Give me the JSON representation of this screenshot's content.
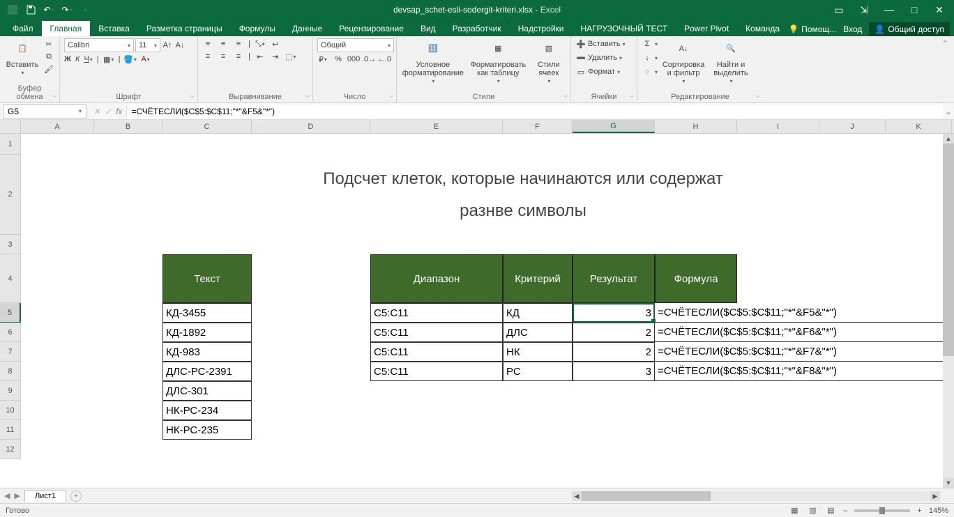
{
  "title": {
    "filename": "devsap_schet-esli-sodergit-kriteri.xlsx",
    "app": "Excel"
  },
  "tabs": [
    "Файл",
    "Главная",
    "Вставка",
    "Разметка страницы",
    "Формулы",
    "Данные",
    "Рецензирование",
    "Вид",
    "Разработчик",
    "Надстройки",
    "НАГРУЗОЧНЫЙ ТЕСТ",
    "Power Pivot",
    "Команда"
  ],
  "activeTab": 1,
  "help": "Помощ...",
  "signin": "Вход",
  "share": "Общий доступ",
  "ribbon": {
    "clipboard": {
      "paste": "Вставить",
      "label": "Буфер обмена"
    },
    "font": {
      "name": "Calibri",
      "size": "11",
      "label": "Шрифт"
    },
    "align": {
      "label": "Выравнивание"
    },
    "number": {
      "format": "Общий",
      "label": "Число"
    },
    "styles": {
      "cond": "Условное форматирование",
      "table": "Форматировать как таблицу",
      "cell": "Стили ячеек",
      "label": "Стили"
    },
    "cells": {
      "insert": "Вставить",
      "delete": "Удалить",
      "format": "Формат",
      "label": "Ячейки"
    },
    "editing": {
      "sort": "Сортировка и фильтр",
      "find": "Найти и выделить",
      "label": "Редактирование"
    }
  },
  "namebox": "G5",
  "formula": "=СЧЁТЕСЛИ($C$5:$C$11;\"*\"&F5&\"*\")",
  "cols": [
    {
      "l": "A",
      "w": 105
    },
    {
      "l": "B",
      "w": 98
    },
    {
      "l": "C",
      "w": 128
    },
    {
      "l": "D",
      "w": 170
    },
    {
      "l": "E",
      "w": 190
    },
    {
      "l": "F",
      "w": 100
    },
    {
      "l": "G",
      "w": 118
    },
    {
      "l": "H",
      "w": 118
    },
    {
      "l": "I",
      "w": 118
    },
    {
      "l": "J",
      "w": 95
    },
    {
      "l": "K",
      "w": 95
    }
  ],
  "rows": [
    {
      "n": 1,
      "h": 30
    },
    {
      "n": 2,
      "h": 115
    },
    {
      "n": 3,
      "h": 28
    },
    {
      "n": 4,
      "h": 70
    },
    {
      "n": 5,
      "h": 28
    },
    {
      "n": 6,
      "h": 28
    },
    {
      "n": 7,
      "h": 28
    },
    {
      "n": 8,
      "h": 28
    },
    {
      "n": 9,
      "h": 28
    },
    {
      "n": 10,
      "h": 28
    },
    {
      "n": 11,
      "h": 28
    },
    {
      "n": 12,
      "h": 28
    }
  ],
  "titleLine1": "Подсчет клеток, которые начинаются или содержат",
  "titleLine2": "разнве символы",
  "headers": {
    "text": "Текст",
    "range": "Диапазон",
    "crit": "Критерий",
    "res": "Результат",
    "form": "Формула"
  },
  "textCol": [
    "КД-3455",
    "КД-1892",
    "КД-983",
    "ДЛС-РС-2391",
    "ДЛС-301",
    "НК-РС-234",
    "НК-РС-235"
  ],
  "rangeCol": [
    "C5:C11",
    "C5:C11",
    "C5:C11",
    "C5:C11"
  ],
  "critCol": [
    "КД",
    "ДЛС",
    "НК",
    "РС"
  ],
  "resCol": [
    "3",
    "2",
    "2",
    "3"
  ],
  "formCol": [
    "=СЧЁТЕСЛИ($C$5:$C$11;\"*\"&F5&\"*\")",
    "=СЧЁТЕСЛИ($C$5:$C$11;\"*\"&F6&\"*\")",
    "=СЧЁТЕСЛИ($C$5:$C$11;\"*\"&F7&\"*\")",
    "=СЧЁТЕСЛИ($C$5:$C$11;\"*\"&F8&\"*\")"
  ],
  "sheet": "Лист1",
  "status": "Готово",
  "zoom": "145%"
}
